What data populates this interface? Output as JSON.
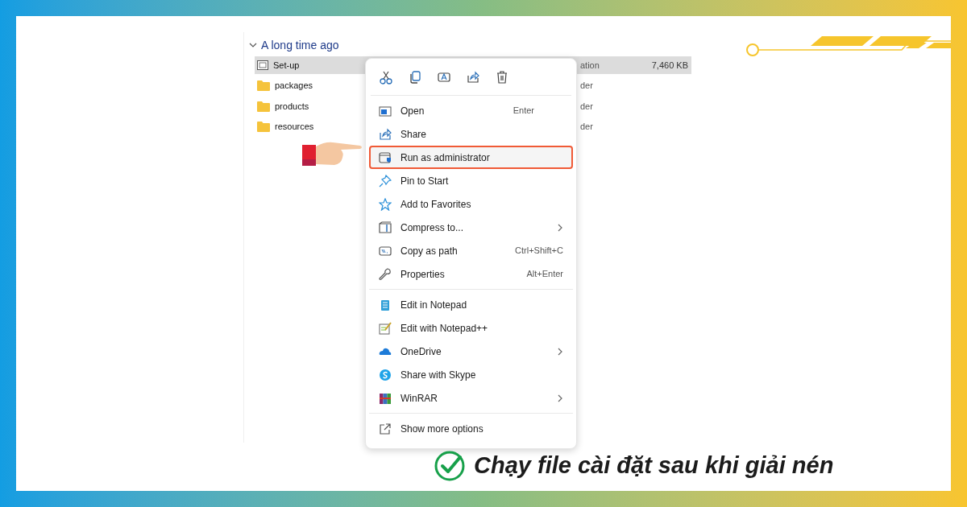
{
  "explorer": {
    "group": {
      "label": "A long time ago",
      "expanded": true
    },
    "files": [
      {
        "name": "Set-up",
        "kind": "app",
        "type": "ation",
        "size": "7,460 KB",
        "selected": true
      },
      {
        "name": "packages",
        "kind": "folder",
        "type": "der",
        "selected": false
      },
      {
        "name": "products",
        "kind": "folder",
        "type": "der",
        "selected": false
      },
      {
        "name": "resources",
        "kind": "folder",
        "type": "der",
        "selected": false
      }
    ]
  },
  "context_menu": {
    "sections": [
      [
        {
          "label": "Open",
          "shortcut": "Enter",
          "selected": false
        },
        {
          "label": "Share",
          "selected": false
        },
        {
          "label": "Run as administrator",
          "selected": true
        },
        {
          "label": "Pin to Start",
          "selected": false
        },
        {
          "label": "Add to Favorites",
          "selected": false
        },
        {
          "label": "Compress to...",
          "submenu": true,
          "selected": false
        },
        {
          "label": "Copy as path",
          "shortcut": "Ctrl+Shift+C",
          "selected": false
        },
        {
          "label": "Properties",
          "shortcut": "Alt+Enter",
          "selected": false
        }
      ],
      [
        {
          "label": "Edit in Notepad",
          "selected": false
        },
        {
          "label": "Edit with Notepad++",
          "selected": false
        },
        {
          "label": "OneDrive",
          "submenu": true,
          "selected": false
        },
        {
          "label": "Share with Skype",
          "selected": false
        },
        {
          "label": "WinRAR",
          "submenu": true,
          "selected": false
        }
      ],
      [
        {
          "label": "Show more options",
          "selected": false
        }
      ]
    ]
  },
  "caption": "Chạy file cài đặt sau khi giải nén"
}
